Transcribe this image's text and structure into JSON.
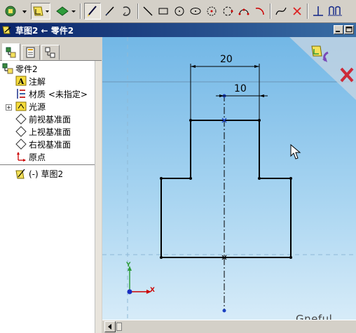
{
  "window": {
    "title": "草图2 ← 零件2"
  },
  "toolbar": {
    "icons": [
      "rebuild-options-icon",
      "sketch-plane-icon",
      "view-orientation-icon",
      "sketch-icon",
      "smart-dimension-icon",
      "add-relation-icon",
      "line-icon",
      "rectangle-icon",
      "circle-icon",
      "ellipse-icon",
      "centerpoint-arc-icon",
      "tangent-arc-icon",
      "three-point-arc-icon",
      "spline-icon",
      "trim-icon",
      "sketch-relations-icon",
      "sketch-grid-icon"
    ]
  },
  "feature_tree": {
    "tabs": [
      "FeatureManager",
      "PropertyManager",
      "ConfigurationManager"
    ],
    "root": "零件2",
    "items": [
      {
        "label": "注解",
        "icon": "annotations-icon"
      },
      {
        "label": "材质 <未指定>",
        "icon": "material-icon"
      },
      {
        "label": "光源",
        "icon": "lights-icon"
      },
      {
        "label": "前视基准面",
        "icon": "plane-icon"
      },
      {
        "label": "上视基准面",
        "icon": "plane-icon"
      },
      {
        "label": "右视基准面",
        "icon": "plane-icon"
      },
      {
        "label": "原点",
        "icon": "origin-icon"
      }
    ],
    "sketch": "(-) 草图2"
  },
  "graphics": {
    "dimension_top": "20",
    "dimension_neck": "10",
    "watermark": "Gneful",
    "axis_y": "Y",
    "axis_x": "X",
    "confirm_corner": [
      "exit-sketch-icon",
      "cancel-sketch-icon"
    ]
  },
  "colors": {
    "titlebar": "#0a246a",
    "viewport_top": "#72b7e6",
    "viewport_bottom": "#dceef9",
    "cancel_red": "#cc2b3a"
  }
}
